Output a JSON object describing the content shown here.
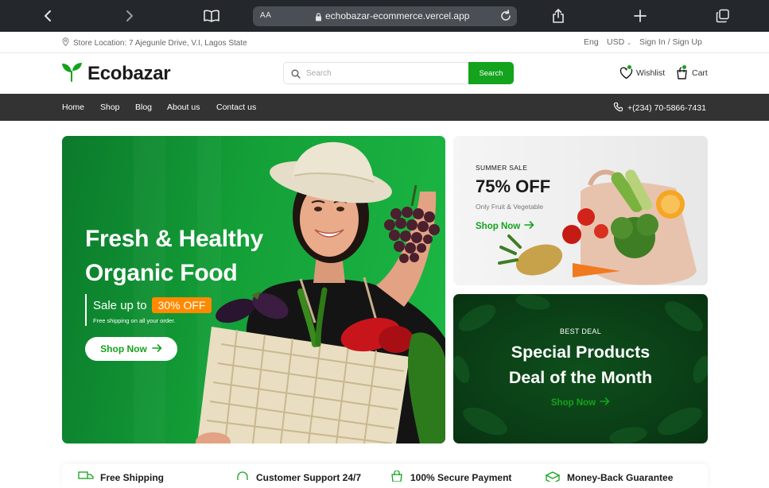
{
  "browser": {
    "aa_label": "AA",
    "url": "echobazar-ecommerce.vercel.app"
  },
  "info_bar": {
    "store_location": "Store Location: 7 Ajegunle Drive, V.I, Lagos State",
    "language": "Eng",
    "currency": "USD",
    "sign_in": "Sign In",
    "separator": "/",
    "sign_up": "Sign Up"
  },
  "header": {
    "logo_text": "Ecobazar",
    "search_placeholder": "Search",
    "search_value": "",
    "search_button": "Search",
    "wishlist_label": "Wishlist",
    "cart_label": "Cart"
  },
  "nav": {
    "items": [
      {
        "label": "Home"
      },
      {
        "label": "Shop"
      },
      {
        "label": "Blog"
      },
      {
        "label": "About us"
      },
      {
        "label": "Contact us"
      }
    ],
    "phone": "+(234) 70-5866-7431"
  },
  "hero": {
    "title_line1": "Fresh & Healthy",
    "title_line2": "Organic Food",
    "sale_prefix": "Sale up to",
    "sale_badge": "30% OFF",
    "shipping_note": "Free shipping on all your order.",
    "cta": "Shop Now"
  },
  "summer_card": {
    "eyebrow": "SUMMER SALE",
    "title": "75% OFF",
    "subtitle": "Only Fruit & Vegetable",
    "cta": "Shop Now"
  },
  "deal_card": {
    "eyebrow": "BEST DEAL",
    "title_line1": "Special Products",
    "title_line2": "Deal of the Month",
    "cta": "Shop Now"
  },
  "features": [
    {
      "label": "Free Shipping",
      "icon": "truck-icon"
    },
    {
      "label": "Customer Support 24/7",
      "icon": "headphones-icon"
    },
    {
      "label": "100% Secure Payment",
      "icon": "shopping-bag-icon"
    },
    {
      "label": "Money-Back Guarantee",
      "icon": "package-icon"
    }
  ],
  "colors": {
    "brand_green": "#14a31d",
    "accent_orange": "#ff8a00",
    "nav_dark": "#333333",
    "browser_chrome": "#24282c"
  }
}
